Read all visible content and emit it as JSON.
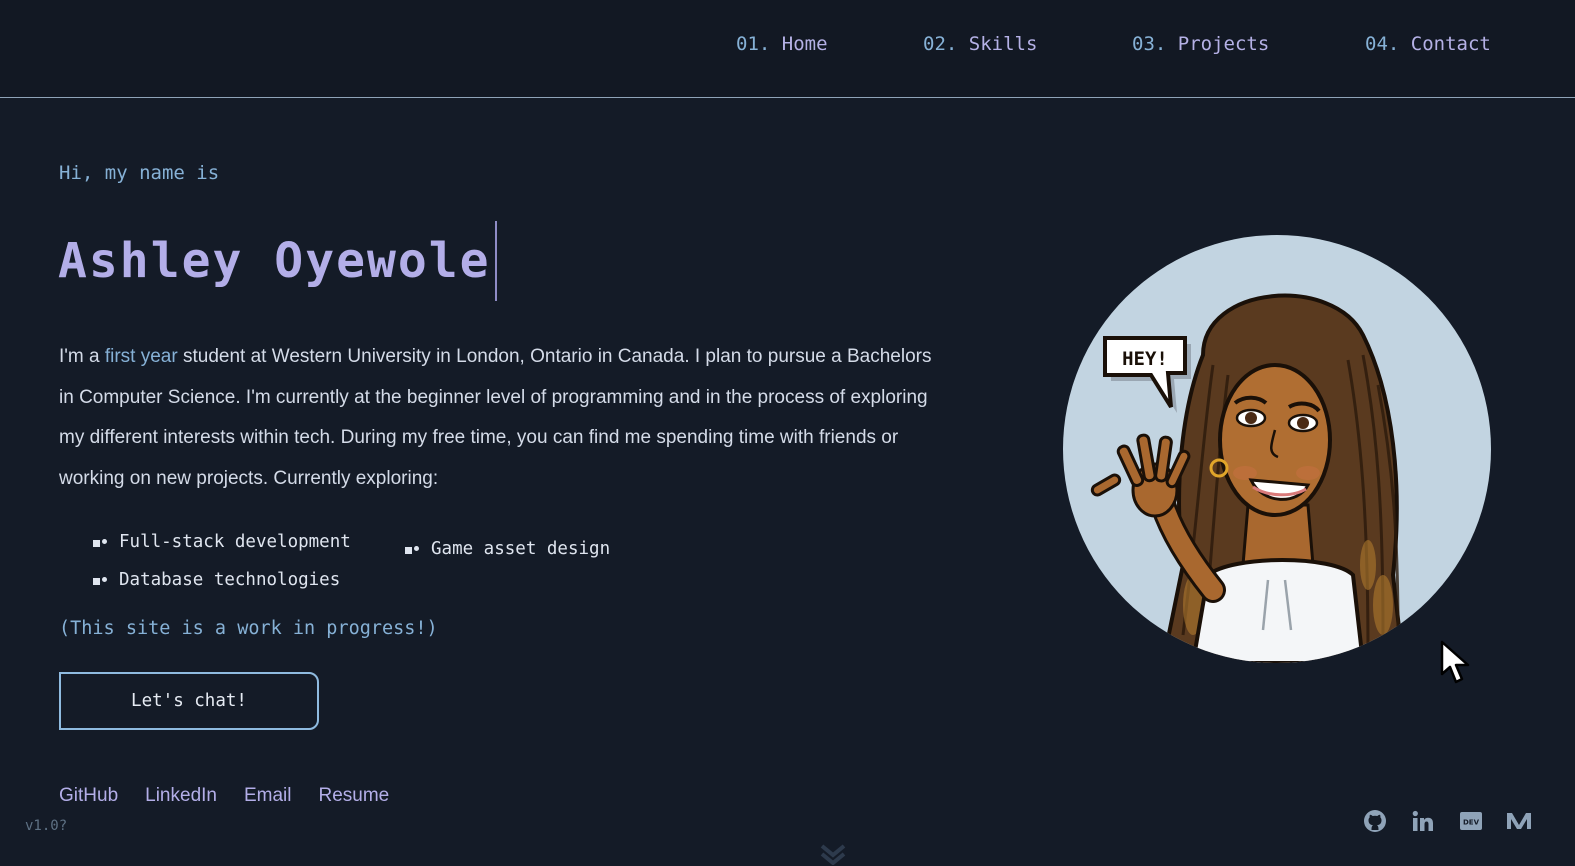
{
  "nav": {
    "items": [
      {
        "num": "01.",
        "label": "Home"
      },
      {
        "num": "02.",
        "label": "Skills"
      },
      {
        "num": "03.",
        "label": "Projects"
      },
      {
        "num": "04.",
        "label": "Contact"
      }
    ]
  },
  "hero": {
    "greeting": "Hi, my name is",
    "name": "Ashley Oyewole",
    "bio_prefix": "I'm a ",
    "bio_highlight": "first year",
    "bio_rest": " student at Western University in London, Ontario in Canada. I plan to pursue a Bachelors in Computer Science. I'm currently at the beginner level of programming and in the process of exploring my different interests within tech. During my free time, you can find me spending time with friends or working on new projects. Currently exploring:",
    "interests": [
      "Full-stack development",
      "Database technologies",
      "Game asset design"
    ],
    "wip_note": "(This site is a work in progress!)",
    "cta_label": "Let's chat!"
  },
  "links": [
    "GitHub",
    "LinkedIn",
    "Email",
    "Resume"
  ],
  "version": "v1.0?",
  "avatar": {
    "speech_bubble": "HEY!"
  },
  "socials": [
    "github-icon",
    "linkedin-icon",
    "dev-icon",
    "medium-icon"
  ],
  "colors": {
    "background": "#141b27",
    "accent_blue": "#86b1d6",
    "accent_purple": "#b3aee8",
    "nav_border": "#8fa3b8"
  }
}
